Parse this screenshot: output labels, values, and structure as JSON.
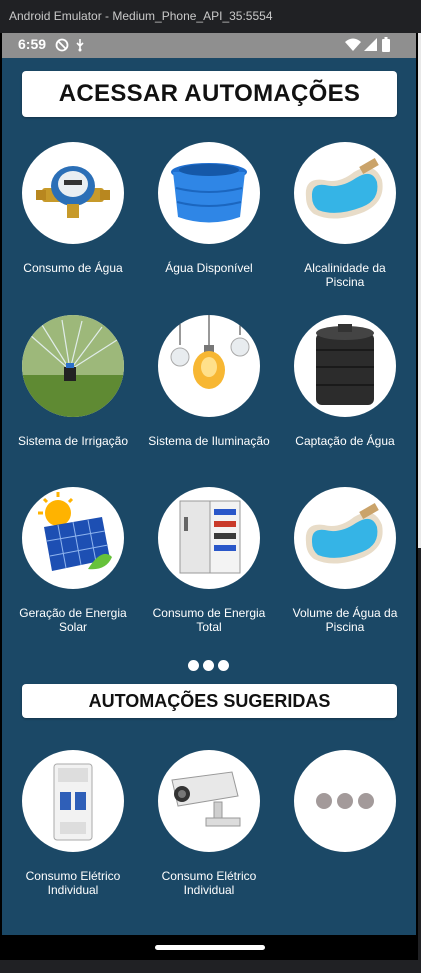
{
  "window": {
    "title": "Android Emulator - Medium_Phone_API_35:5554"
  },
  "status_bar": {
    "time": "6:59"
  },
  "section_access": {
    "title": "ACESSAR AUTOMAÇÕES",
    "tiles": [
      {
        "label": "Consumo de Água",
        "icon": "water-meter-icon"
      },
      {
        "label": "Água Disponível",
        "icon": "water-tank-icon"
      },
      {
        "label": "Alcalinidade da Piscina",
        "icon": "pool-icon"
      },
      {
        "label": "Sistema de Irrigação",
        "icon": "sprinkler-icon"
      },
      {
        "label": "Sistema de Iluminação",
        "icon": "lightbulbs-icon"
      },
      {
        "label": "Captação de Água",
        "icon": "cistern-icon"
      },
      {
        "label": "Geração de Energia Solar",
        "icon": "solar-panel-icon"
      },
      {
        "label": "Consumo de Energia Total",
        "icon": "electrical-panel-icon"
      },
      {
        "label": "Volume de Água da Piscina",
        "icon": "pool-icon"
      }
    ]
  },
  "pagination": {
    "dots": 3
  },
  "section_suggested": {
    "title": "AUTOMAÇÕES SUGERIDAS",
    "tiles": [
      {
        "label": "Consumo Elétrico Individual",
        "icon": "circuit-breaker-icon"
      },
      {
        "label": "Consumo Elétrico Individual",
        "icon": "security-camera-icon"
      },
      {
        "label": "",
        "icon": "more-icon"
      }
    ]
  },
  "colors": {
    "background": "#1b4866",
    "card": "#ffffff",
    "status_bar": "#8f8f8f"
  }
}
